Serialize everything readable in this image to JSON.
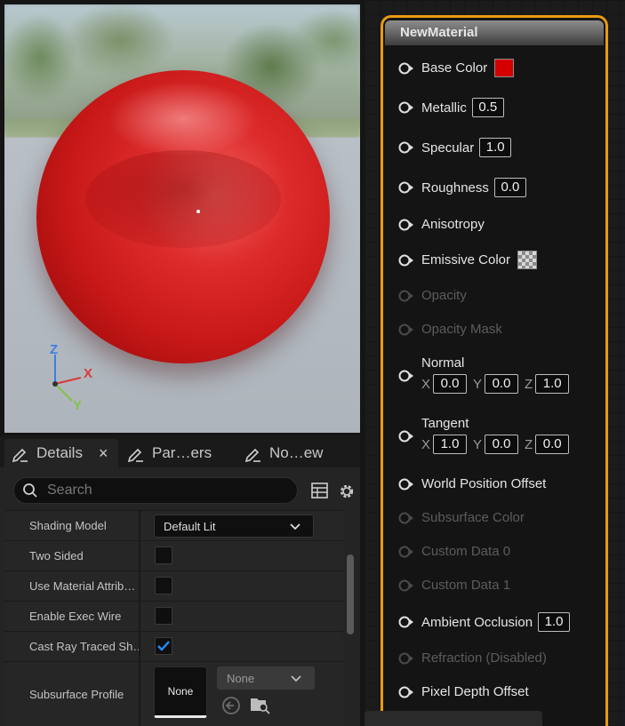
{
  "viewport": {
    "gizmo": {
      "z_label": "Z",
      "x_label": "X",
      "y_label": "Y"
    }
  },
  "details": {
    "tabs": [
      {
        "label": "Details",
        "close": "×"
      },
      {
        "label": "Par…ers"
      },
      {
        "label": "No…ew"
      }
    ],
    "search_placeholder": "Search",
    "properties": [
      {
        "label": "Shading Model",
        "value": "Default Lit"
      },
      {
        "label": "Two Sided",
        "checked": false
      },
      {
        "label": "Use Material Attrib…",
        "checked": false
      },
      {
        "label": "Enable Exec Wire",
        "checked": false
      },
      {
        "label": "Cast Ray Traced Sh…",
        "checked": true
      },
      {
        "label": "Subsurface Profile",
        "asset": "None",
        "combo": "None"
      }
    ]
  },
  "node": {
    "title": "NewMaterial",
    "pins": [
      {
        "label": "Base Color",
        "color": "#d40000"
      },
      {
        "label": "Metallic",
        "value": "0.5"
      },
      {
        "label": "Specular",
        "value": "1.0"
      },
      {
        "label": "Roughness",
        "value": "0.0"
      },
      {
        "label": "Anisotropy"
      },
      {
        "label": "Emissive Color"
      },
      {
        "label": "Opacity"
      },
      {
        "label": "Opacity Mask"
      },
      {
        "label": "Normal",
        "x": "0.0",
        "y": "0.0",
        "z": "1.0"
      },
      {
        "label": "Tangent",
        "x": "1.0",
        "y": "0.0",
        "z": "0.0"
      },
      {
        "label": "World Position Offset"
      },
      {
        "label": "Subsurface Color"
      },
      {
        "label": "Custom Data 0"
      },
      {
        "label": "Custom Data 1"
      },
      {
        "label": "Ambient Occlusion",
        "value": "1.0"
      },
      {
        "label": "Refraction (Disabled)"
      },
      {
        "label": "Pixel Depth Offset"
      }
    ],
    "axis_labels": {
      "x": "X",
      "y": "Y",
      "z": "Z"
    }
  },
  "colors": {
    "node_border": "#e99b0f",
    "checkbox_check": "#1f8fff",
    "gizmo_x": "#d83a3a",
    "gizmo_y": "#7fc24a",
    "gizmo_z": "#3b7ee6"
  }
}
